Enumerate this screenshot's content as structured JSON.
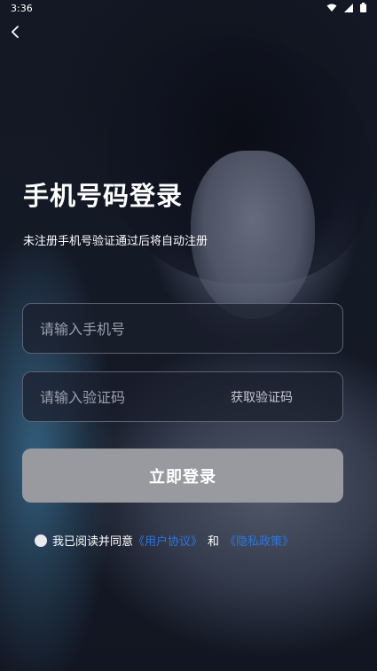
{
  "status_bar": {
    "time": "3:36",
    "icons": [
      "wifi-icon",
      "signal-icon",
      "battery-icon"
    ]
  },
  "nav": {
    "back_icon": "chevron-left-icon"
  },
  "header": {
    "title": "手机号码登录",
    "subtitle": "未注册手机号验证通过后将自动注册"
  },
  "form": {
    "phone_placeholder": "请输入手机号",
    "phone_value": "",
    "code_placeholder": "请输入验证码",
    "code_value": "",
    "get_code_label": "获取验证码",
    "login_label": "立即登录"
  },
  "agreement": {
    "checked": false,
    "prefix": "我已阅读并同意",
    "user_agreement": "《用户协议》",
    "conjunction": "和",
    "privacy_policy": "《隐私政策》"
  },
  "colors": {
    "link": "#2a77e0",
    "button_disabled": "#999aa0",
    "field_border": "#5d6273"
  }
}
